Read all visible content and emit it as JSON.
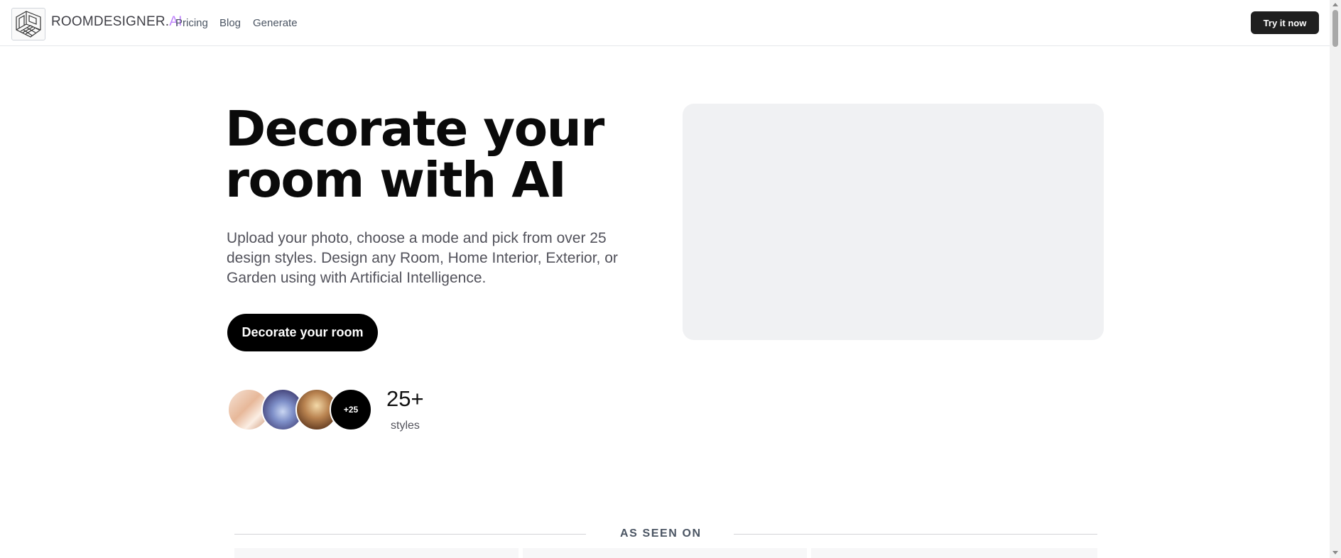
{
  "header": {
    "brand_main": "ROOMDESIGNER.",
    "brand_accent": "AI",
    "nav": [
      "Pricing",
      "Blog",
      "Generate"
    ],
    "cta_label": "Try it now"
  },
  "hero": {
    "title": "Decorate your room with AI",
    "subtitle": "Upload your photo, choose a mode and pick from over 25 design styles. Design any Room, Home Interior, Exterior, or Garden using with Artificial Intelligence.",
    "cta_label": "Decorate your room",
    "more_badge": "+25",
    "styles_count": "25+",
    "styles_label": "styles"
  },
  "seen_on": {
    "heading": "AS SEEN ON"
  },
  "colors": {
    "brand_accent": "#c084fc",
    "primary_button": "#000000",
    "nav_button": "#1f1f1f",
    "placeholder": "#f0f1f3"
  }
}
